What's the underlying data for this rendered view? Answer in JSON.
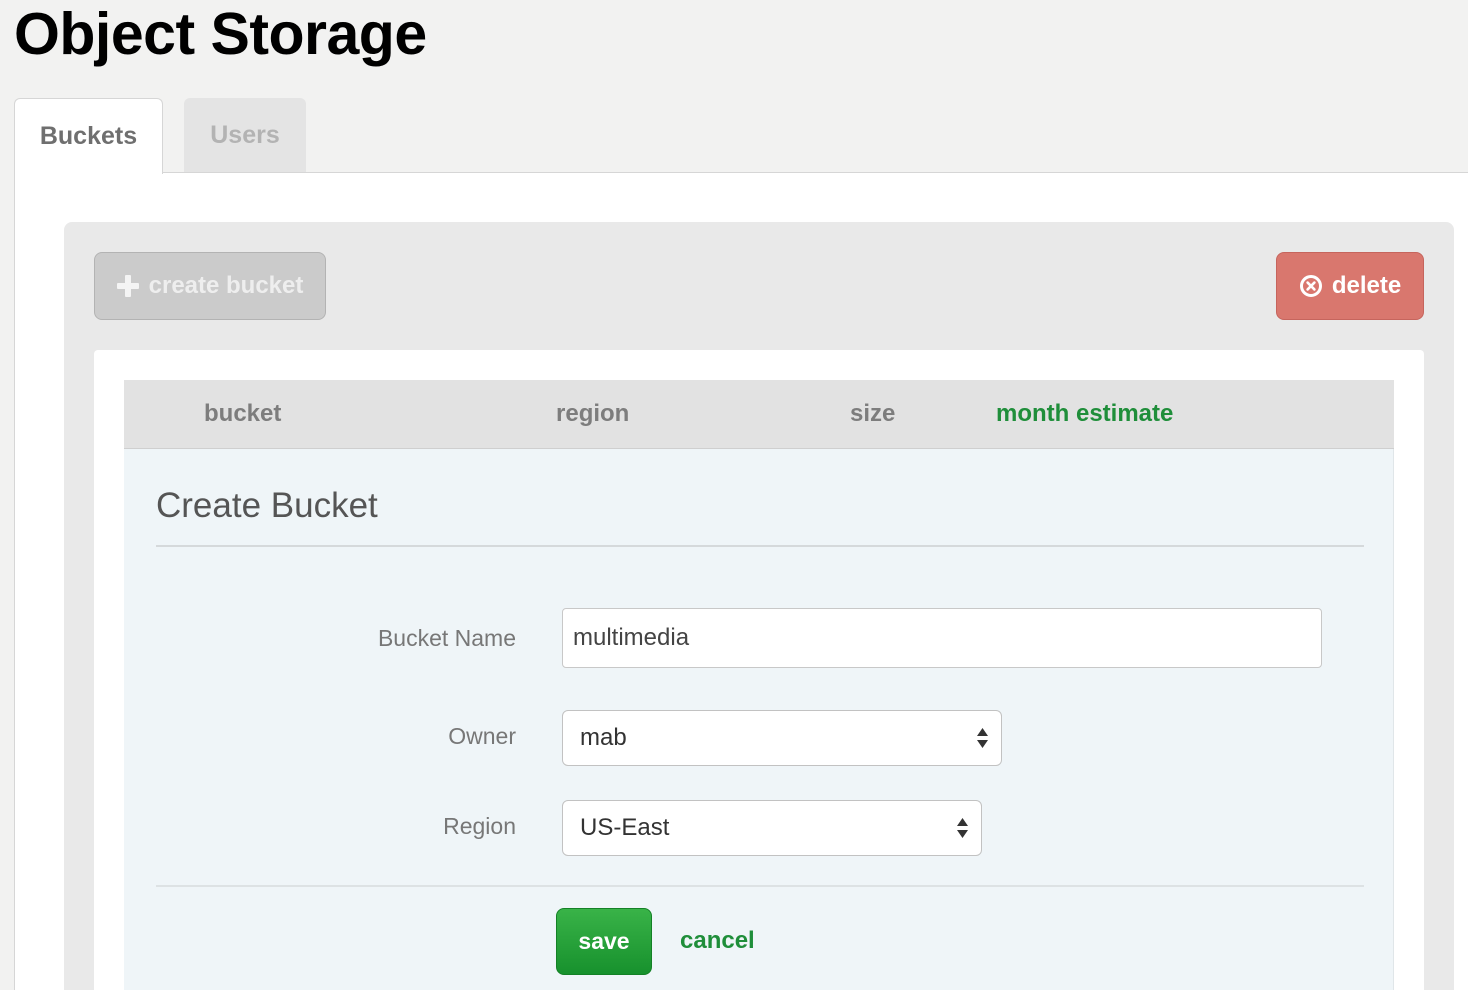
{
  "page": {
    "title": "Object Storage"
  },
  "tabs": [
    {
      "label": "Buckets",
      "active": true
    },
    {
      "label": "Users",
      "active": false
    }
  ],
  "toolbar": {
    "create_label": "create bucket",
    "create_icon": "plus-icon",
    "delete_label": "delete",
    "delete_icon": "circle-x-icon"
  },
  "table": {
    "columns": [
      "bucket",
      "region",
      "size",
      "month estimate"
    ]
  },
  "form": {
    "title": "Create Bucket",
    "fields": {
      "bucket_name": {
        "label": "Bucket Name",
        "value": "multimedia"
      },
      "owner": {
        "label": "Owner",
        "value": "mab"
      },
      "region": {
        "label": "Region",
        "value": "US-East"
      }
    },
    "save_label": "save",
    "cancel_label": "cancel"
  },
  "colors": {
    "accent_green": "#1f8e3a",
    "save_green": "#28a23b",
    "delete_red": "#d9776e",
    "form_bg": "#eff5f8"
  }
}
